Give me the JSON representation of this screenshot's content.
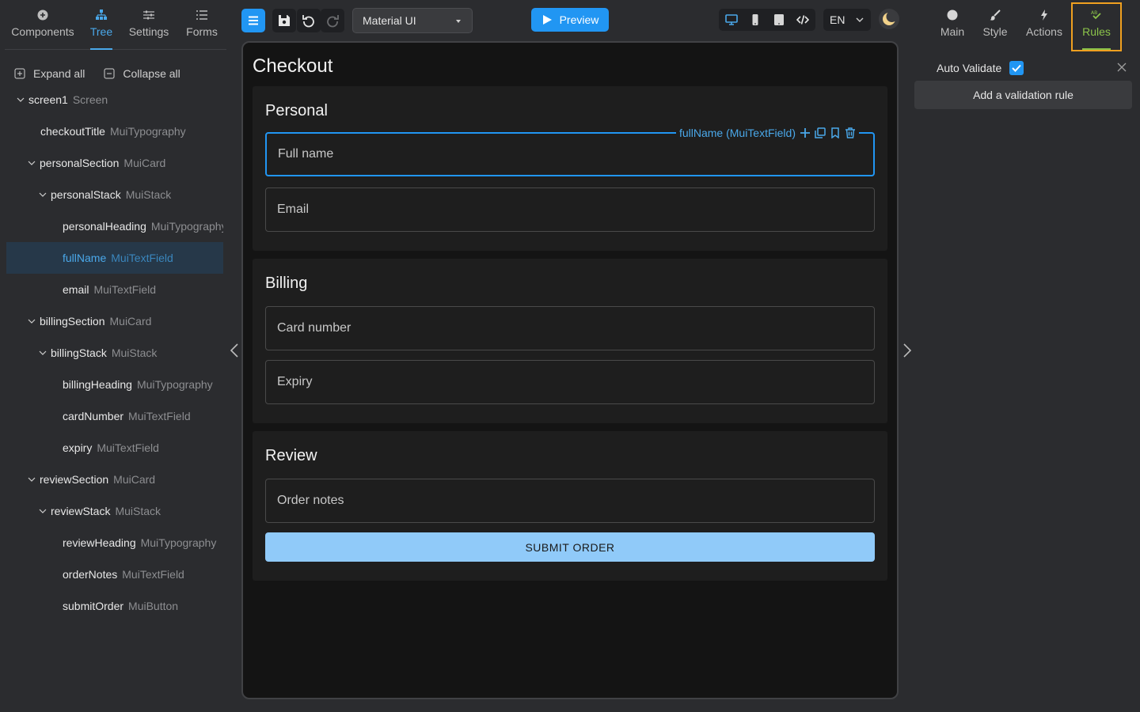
{
  "left_tabs": [
    {
      "label": "Components",
      "icon": "plus-circle-icon"
    },
    {
      "label": "Tree",
      "icon": "tree-icon"
    },
    {
      "label": "Settings",
      "icon": "sliders-icon"
    },
    {
      "label": "Forms",
      "icon": "list-icon"
    }
  ],
  "tree_actions": {
    "expand_all": "Expand all",
    "collapse_all": "Collapse all"
  },
  "tree": [
    {
      "name": "screen1",
      "type": "Screen"
    },
    {
      "name": "checkoutTitle",
      "type": "MuiTypography"
    },
    {
      "name": "personalSection",
      "type": "MuiCard"
    },
    {
      "name": "personalStack",
      "type": "MuiStack"
    },
    {
      "name": "personalHeading",
      "type": "MuiTypography"
    },
    {
      "name": "fullName",
      "type": "MuiTextField"
    },
    {
      "name": "email",
      "type": "MuiTextField"
    },
    {
      "name": "billingSection",
      "type": "MuiCard"
    },
    {
      "name": "billingStack",
      "type": "MuiStack"
    },
    {
      "name": "billingHeading",
      "type": "MuiTypography"
    },
    {
      "name": "cardNumber",
      "type": "MuiTextField"
    },
    {
      "name": "expiry",
      "type": "MuiTextField"
    },
    {
      "name": "reviewSection",
      "type": "MuiCard"
    },
    {
      "name": "reviewStack",
      "type": "MuiStack"
    },
    {
      "name": "reviewHeading",
      "type": "MuiTypography"
    },
    {
      "name": "orderNotes",
      "type": "MuiTextField"
    },
    {
      "name": "submitOrder",
      "type": "MuiButton"
    }
  ],
  "toolbar": {
    "framework": "Material UI",
    "preview": "Preview",
    "language": "EN"
  },
  "canvas": {
    "title": "Checkout",
    "selection_label": "fullName (MuiTextField)",
    "personal": {
      "heading": "Personal",
      "full_name": "Full name",
      "email": "Email"
    },
    "billing": {
      "heading": "Billing",
      "card_number": "Card number",
      "expiry": "Expiry"
    },
    "review": {
      "heading": "Review",
      "order_notes": "Order notes",
      "submit": "SUBMIT ORDER"
    }
  },
  "right_tabs": [
    {
      "label": "Main",
      "icon": "circle-icon"
    },
    {
      "label": "Style",
      "icon": "brush-icon"
    },
    {
      "label": "Actions",
      "icon": "bolt-icon"
    },
    {
      "label": "Rules",
      "icon": "rules-icon"
    }
  ],
  "rules": {
    "auto_validate": "Auto Validate",
    "auto_validate_checked": true,
    "add_rule": "Add a validation rule"
  },
  "colors": {
    "accent": "#2196f3",
    "rules_active": "#8bc34a",
    "highlight": "#f0a020",
    "submit": "#90caf9"
  }
}
